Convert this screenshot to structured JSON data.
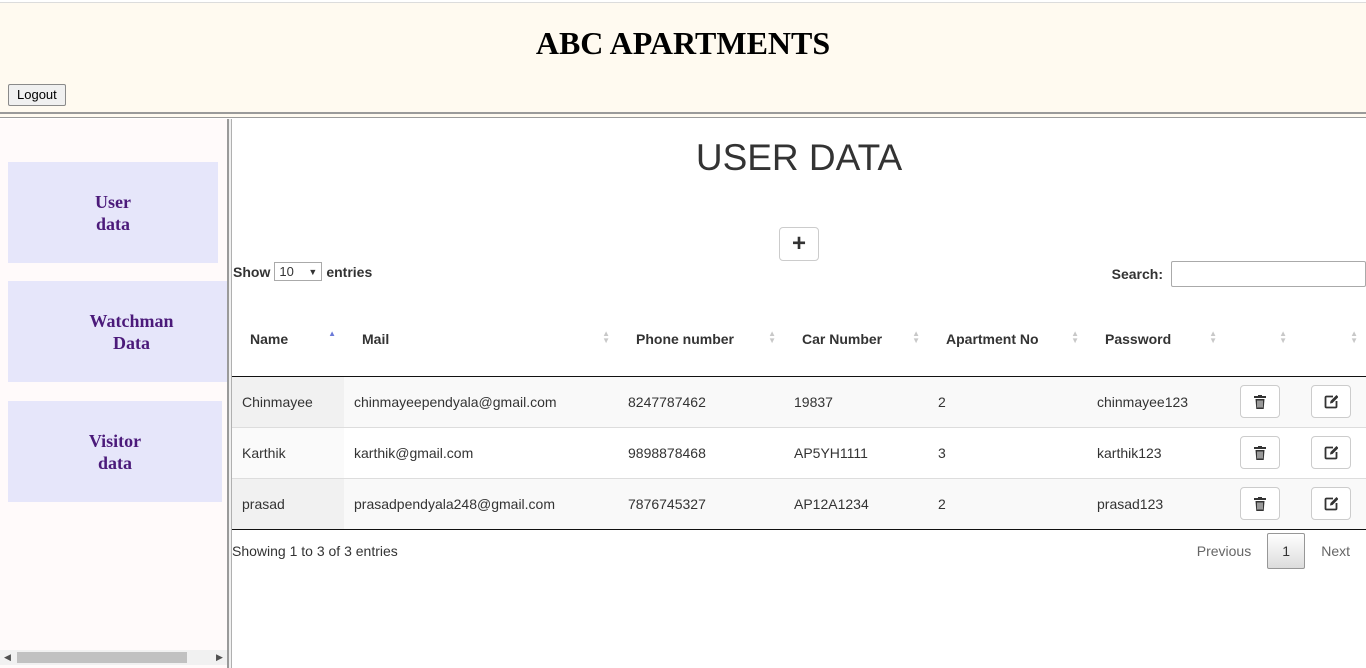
{
  "header": {
    "title": "ABC APARTMENTS",
    "logout_label": "Logout"
  },
  "sidebar": {
    "items": [
      {
        "line1": "User",
        "line2": "data"
      },
      {
        "line1": "Watchman",
        "line2": "Data"
      },
      {
        "line1": "Visitor",
        "line2": "data"
      }
    ]
  },
  "main": {
    "title": "USER DATA",
    "add_button": "+",
    "show_label": "Show",
    "page_length": "10",
    "entries_label": "entries",
    "search_label": "Search:",
    "search_value": ""
  },
  "table": {
    "columns": [
      "Name",
      "Mail",
      "Phone number",
      "Car Number",
      "Apartment No",
      "Password",
      "",
      ""
    ],
    "rows": [
      [
        "Chinmayee",
        "chinmayeependyala@gmail.com",
        "8247787462",
        "19837",
        "2",
        "chinmayee123"
      ],
      [
        "Karthik",
        "karthik@gmail.com",
        "9898878468",
        "AP5YH1111",
        "3",
        "karthik123"
      ],
      [
        "prasad",
        "prasadpendyala248@gmail.com",
        "7876745327",
        "AP12A1234",
        "2",
        "prasad123"
      ]
    ],
    "sorted_column": "Name",
    "sort_direction": "ascending",
    "row_actions": [
      "trash-icon",
      "edit-icon"
    ]
  },
  "footer": {
    "info": "Showing 1 to 3 of 3 entries",
    "previous": "Previous",
    "current_page": "1",
    "next": "Next"
  }
}
